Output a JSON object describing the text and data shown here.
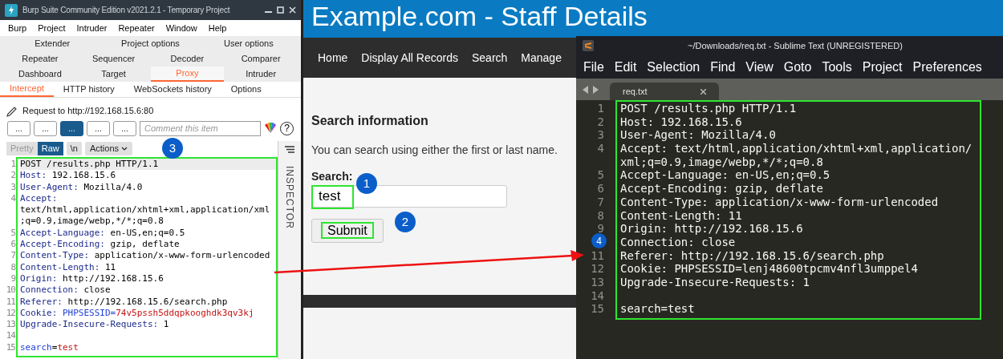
{
  "browser": {
    "site_title": "Example.com - Staff Details",
    "nav": [
      "Home",
      "Display All Records",
      "Search",
      "Manage"
    ],
    "heading": "Search information",
    "intro": "You can search using either the first or last name.",
    "search_label": "Search:",
    "search_value": "test",
    "submit": "Submit"
  },
  "burp": {
    "title": "Burp Suite Community Edition v2021.2.1 - Temporary Project",
    "menu": [
      "Burp",
      "Project",
      "Intruder",
      "Repeater",
      "Window",
      "Help"
    ],
    "tab_rows": [
      [
        {
          "label": "Extender",
          "selected": false
        },
        {
          "label": "Project options",
          "selected": false
        },
        {
          "label": "User options",
          "selected": false
        }
      ],
      [
        {
          "label": "Repeater",
          "selected": false
        },
        {
          "label": "Sequencer",
          "selected": false
        },
        {
          "label": "Decoder",
          "selected": false
        },
        {
          "label": "Comparer",
          "selected": false
        }
      ],
      [
        {
          "label": "Dashboard",
          "selected": false
        },
        {
          "label": "Target",
          "selected": false
        },
        {
          "label": "Proxy",
          "selected": true
        },
        {
          "label": "Intruder",
          "selected": false
        }
      ]
    ],
    "subtabs": [
      {
        "label": "Intercept",
        "selected": true
      },
      {
        "label": "HTTP history",
        "selected": false
      },
      {
        "label": "WebSockets history",
        "selected": false
      },
      {
        "label": "Options",
        "selected": false
      }
    ],
    "request_to": "Request to http://192.168.15.6:80",
    "action_buttons": [
      {
        "label": "...",
        "selected": false
      },
      {
        "label": "...",
        "selected": false
      },
      {
        "label": "...",
        "selected": true
      },
      {
        "label": "...",
        "selected": false
      },
      {
        "label": "...",
        "selected": false
      }
    ],
    "comment_placeholder": "Comment this item",
    "help": "?",
    "view_toggles": [
      {
        "label": "Pretty",
        "selected": false
      },
      {
        "label": "Raw",
        "selected": true
      }
    ],
    "newline_toggle": "\\n",
    "actions": "Actions",
    "inspector": "INSPECTOR",
    "lines": [
      {
        "number": "1",
        "segments": [
          {
            "text": "POST /results.php HTTP/1.1",
            "kind": "plain"
          }
        ]
      },
      {
        "number": "2",
        "segments": [
          {
            "text": "Host:",
            "kind": "key"
          },
          {
            "text": "192.168.15.6",
            "kind": "plain"
          }
        ]
      },
      {
        "number": "3",
        "segments": [
          {
            "text": "User-Agent:",
            "kind": "key"
          },
          {
            "text": "Mozilla/4.0",
            "kind": "plain"
          }
        ]
      },
      {
        "number": "4",
        "segments": [
          {
            "text": "Accept:",
            "kind": "key"
          }
        ],
        "continuation": [
          "text/html,application/xhtml+xml,application/xml",
          ";q=0.9,image/webp,*/*;q=0.8"
        ]
      },
      {
        "number": "5",
        "segments": [
          {
            "text": "Accept-Language:",
            "kind": "key"
          },
          {
            "text": "en-US,en;q=0.5",
            "kind": "plain"
          }
        ]
      },
      {
        "number": "6",
        "segments": [
          {
            "text": "Accept-Encoding:",
            "kind": "key"
          },
          {
            "text": "gzip, deflate",
            "kind": "plain"
          }
        ]
      },
      {
        "number": "7",
        "segments": [
          {
            "text": "Content-Type:",
            "kind": "key"
          },
          {
            "text": "application/x-www-form-urlencoded",
            "kind": "plain"
          }
        ]
      },
      {
        "number": "8",
        "segments": [
          {
            "text": "Content-Length:",
            "kind": "key"
          },
          {
            "text": "11",
            "kind": "plain"
          }
        ]
      },
      {
        "number": "9",
        "segments": [
          {
            "text": "Origin:",
            "kind": "key"
          },
          {
            "text": "http://192.168.15.6",
            "kind": "plain"
          }
        ]
      },
      {
        "number": "10",
        "segments": [
          {
            "text": "Connection:",
            "kind": "key"
          },
          {
            "text": "close",
            "kind": "plain"
          }
        ]
      },
      {
        "number": "11",
        "segments": [
          {
            "text": "Referer:",
            "kind": "key"
          },
          {
            "text": "http://192.168.15.6/search.php",
            "kind": "plain"
          }
        ]
      },
      {
        "number": "12",
        "segments": [
          {
            "text": "Cookie:",
            "kind": "key"
          },
          {
            "text": "PHPSESSID=",
            "kind": "param"
          },
          {
            "text": "74v5pssh5ddqpkooghdk3qv3kj",
            "kind": "value"
          }
        ]
      },
      {
        "number": "13",
        "segments": [
          {
            "text": "Upgrade-Insecure-Requests:",
            "kind": "key"
          },
          {
            "text": "1",
            "kind": "plain"
          }
        ]
      },
      {
        "number": "14"
      },
      {
        "number": "15",
        "segments": [
          {
            "text": "search",
            "kind": "param"
          },
          {
            "text": "=",
            "kind": "plain"
          },
          {
            "text": "test",
            "kind": "value"
          }
        ]
      }
    ]
  },
  "sublime": {
    "title": "~/Downloads/req.txt - Sublime Text (UNREGISTERED)",
    "menu": [
      "File",
      "Edit",
      "Selection",
      "Find",
      "View",
      "Goto",
      "Tools",
      "Project",
      "Preferences"
    ],
    "tab": "req.txt",
    "lines": [
      {
        "number": "1",
        "text": "POST /results.php HTTP/1.1"
      },
      {
        "number": "2",
        "text": "Host: 192.168.15.6"
      },
      {
        "number": "3",
        "text": "User-Agent: Mozilla/4.0"
      },
      {
        "number": "4",
        "text": "Accept: text/html,application/xhtml+xml,application/",
        "continuation": [
          "xml;q=0.9,image/webp,*/*;q=0.8"
        ]
      },
      {
        "number": "5",
        "text": "Accept-Language: en-US,en;q=0.5"
      },
      {
        "number": "6",
        "text": "Accept-Encoding: gzip, deflate"
      },
      {
        "number": "7",
        "text": "Content-Type: application/x-www-form-urlencoded"
      },
      {
        "number": "8",
        "text": "Content-Length: 11"
      },
      {
        "number": "9",
        "text": "Origin: http://192.168.15.6"
      },
      {
        "text": "Connection: close"
      },
      {
        "number": "11",
        "text": "Referer: http://192.168.15.6/search.php"
      },
      {
        "number": "12",
        "text": "Cookie: PHPSESSID=lenj48600tpcmv4nfl3umppel4"
      },
      {
        "number": "13",
        "text": "Upgrade-Insecure-Requests: 1"
      },
      {
        "number": "14"
      },
      {
        "number": "15",
        "text": "search=test"
      }
    ]
  },
  "markers": [
    "1",
    "2",
    "3",
    "4"
  ]
}
